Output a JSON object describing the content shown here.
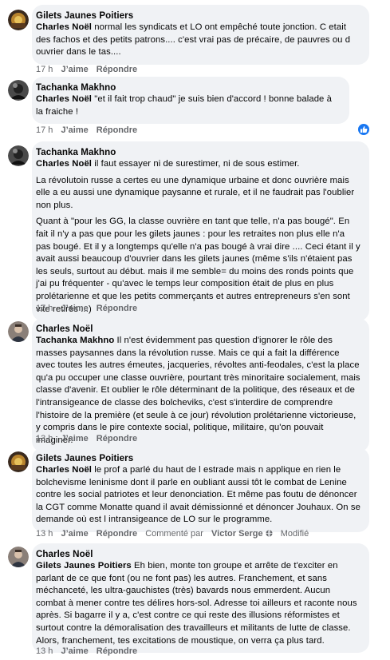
{
  "comments": [
    {
      "author": "Gilets Jaunes Poitiers",
      "mention": "Charles Noël",
      "text": " normal les syndicats et LO ont empêché toute jonction. C etait des fachos et des petits patrons.... c'est vrai pas de précaire, de pauvres ou d ouvrier dans le tas....",
      "time": "17 h",
      "like": "J’aime",
      "reply": "Répondre"
    },
    {
      "author": "Tachanka Makhno",
      "mention": "Charles Noël",
      "text": " \"et il fait trop chaud\" je suis bien d'accord ! bonne balade à la fraiche !",
      "time": "17 h",
      "like": "J’aime",
      "reply": "Répondre"
    },
    {
      "author": "Tachanka Makhno",
      "mention": "Charles Noël",
      "text": " il faut essayer ni de surestimer, ni de sous estimer.",
      "para2": "La révolutoin russe a certes eu une dynamique urbaine et donc ouvrière mais elle a eu aussi une dynamique paysanne et rurale, et il ne faudrait pas l'oublier non plus.",
      "para3": "Quant à \"pour les GG, la classe ouvrière en tant que telle, n'a pas bougé\". En fait il n'y a pas que pour les gilets jaunes : pour les retraites non plus elle n'a pas bougé. Et il y a longtemps qu'elle n'a pas bougé à vrai dire .... Ceci étant il y avait aussi beaucoup d'ouvrier dans les gilets jaunes (même s'ils n'étaient pas les seuls, surtout au début. mais il me semble= du moins des ronds points que j'ai pu fréquenter - qu'avec le temps leur composition était de plus en plus prolétarienne et que les petits commerçants et autres entrepreneurs s'en sont vite retirés ...)",
      "time": "17 h",
      "like": "J’aime",
      "reply": "Répondre"
    },
    {
      "author": "Charles Noël",
      "mention": "Tachanka Makhno",
      "text": " Il n'est évidemment pas question d'ignorer le rôle des masses paysannes dans la révolution russe. Mais ce qui a fait la différence avec toutes les autres émeutes, jacqueries, révoltes anti-feodales, c'est la place qu'a pu occuper une classe ouvrière, pourtant très minoritaire socialement, mais classe d'avenir. Et oublier le rôle déterminant de la politique, des réseaux et de l'intransigeance de classe des bolcheviks, c'est s'interdire de comprendre l'histoire de la première (et seule à ce jour) révolution prolétarienne victorieuse, y compris dans le pire contexte social, politique, militaire, qu'on pouvait imaginer.",
      "time": "13 h",
      "like": "J’aime",
      "reply": "Répondre"
    },
    {
      "author": "Gilets Jaunes Poitiers",
      "mention": "Charles Noël",
      "text": " le prof a parlé du haut de l estrade mais n applique en rien le bolchevisme leninisme dont il parle en oubliant aussi tôt le combat de Lenine contre les social patriotes et leur denonciation. Et même pas foutu de dénoncer la CGT comme Monatte quand il avait démissionné et dénoncer Jouhaux. On se demande où est l intransigeance de LO sur le programme.",
      "time": "13 h",
      "like": "J’aime",
      "reply": "Répondre",
      "comment_by": "Commenté par",
      "comment_by_name": "Victor Serge",
      "edited": "Modifié"
    },
    {
      "author": "Charles Noël",
      "mention": "Gilets Jaunes Poitiers",
      "text": " Eh bien, monte ton groupe et arrête de t'exciter en parlant de ce que font (ou ne font pas) les autres. Franchement, et sans méchanceté, les ultra-gauchistes (très) bavards nous emmerdent. Aucun combat à mener contre tes délires hors-sol. Adresse toi ailleurs et raconte nous après. Si bagarre il y a, c'est contre ce qui reste des illusions réformistes et surtout contre la démoralisation des travailleurs et militants de lutte de classe. Alors, franchement, tes excitations de moustique, on verra ça plus tard.",
      "time": "13 h",
      "like": "J’aime",
      "reply": "Répondre"
    }
  ],
  "colors": {
    "bubble": "#f0f2f5",
    "meta": "#65676b",
    "like_badge": "#1877f2"
  },
  "icons": [
    "avatar-gilets-jaunes",
    "avatar-tachanka",
    "avatar-charles",
    "like-thumb-icon",
    "globe-icon"
  ]
}
